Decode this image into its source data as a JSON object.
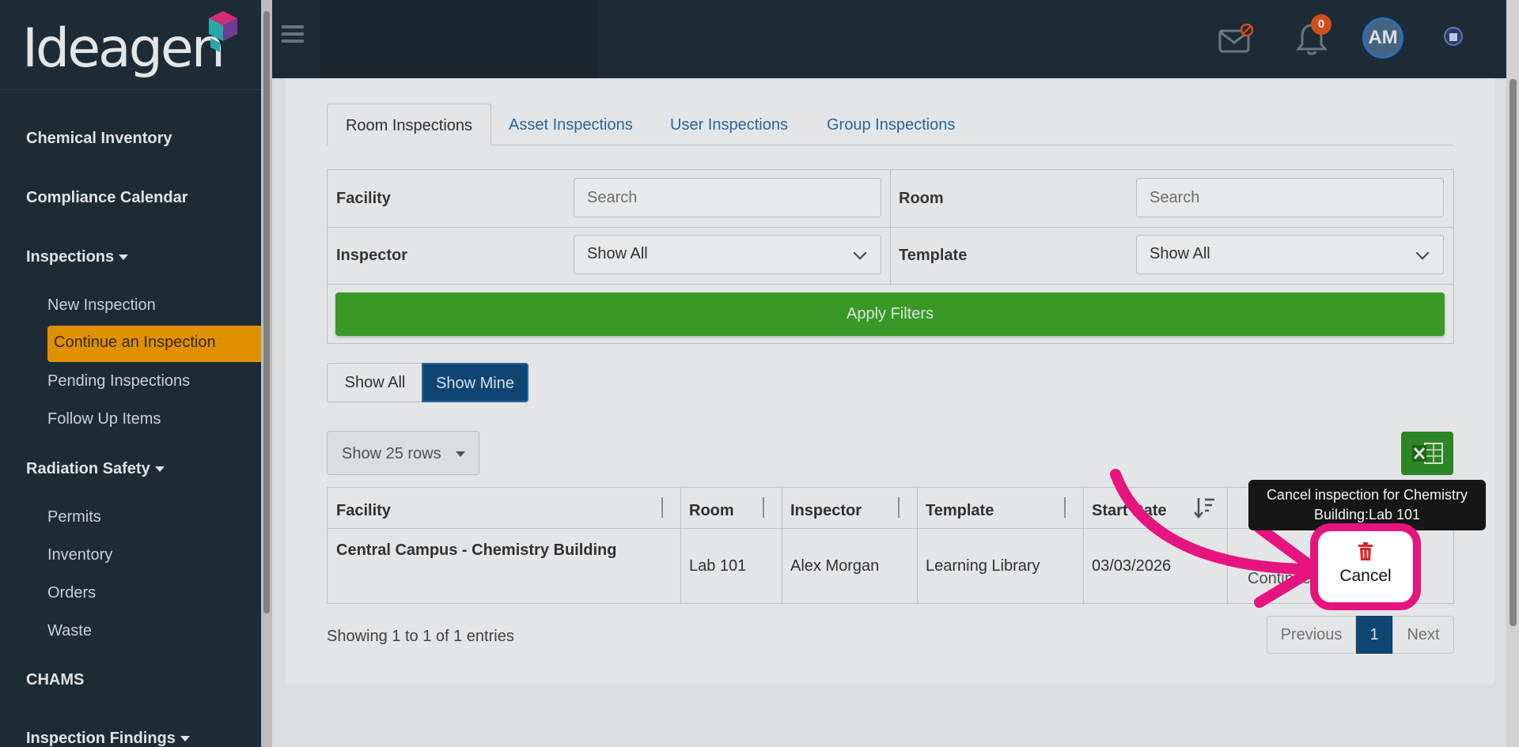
{
  "brand": {
    "name": "Ideagen"
  },
  "sidebar": {
    "sections": [
      {
        "label": "Chemical Inventory"
      },
      {
        "label": "Compliance Calendar"
      },
      {
        "label": "Inspections"
      },
      {
        "label": "Radiation Safety"
      },
      {
        "label": "CHAMS"
      },
      {
        "label": "Inspection Findings"
      }
    ],
    "inspections_items": [
      "New Inspection",
      "Continue an Inspection",
      "Pending Inspections",
      "Follow Up Items"
    ],
    "radiation_items": [
      "Permits",
      "Inventory",
      "Orders",
      "Waste"
    ],
    "active_item": "Continue an Inspection"
  },
  "header": {
    "notifications_count": "0",
    "avatar_initials": "AM"
  },
  "tabs": [
    {
      "label": "Room Inspections"
    },
    {
      "label": "Asset Inspections"
    },
    {
      "label": "User Inspections"
    },
    {
      "label": "Group Inspections"
    }
  ],
  "filters": {
    "facility_label": "Facility",
    "facility_placeholder": "Search",
    "room_label": "Room",
    "room_placeholder": "Search",
    "inspector_label": "Inspector",
    "inspector_value": "Show All",
    "template_label": "Template",
    "template_value": "Show All",
    "apply_label": "Apply Filters"
  },
  "toggle": {
    "all": "Show All",
    "mine": "Show Mine"
  },
  "rows_selector": "Show 25 rows",
  "table": {
    "columns": [
      "Facility",
      "Room",
      "Inspector",
      "Template",
      "Start Date"
    ],
    "rows": [
      {
        "facility": "Central Campus - Chemistry Building",
        "room": "Lab 101",
        "inspector": "Alex Morgan",
        "template": "Learning Library",
        "start_date": "03/03/2026",
        "action": "Continue"
      }
    ]
  },
  "footer": {
    "showing": "Showing 1 to 1 of 1 entries",
    "previous": "Previous",
    "page": "1",
    "next": "Next"
  },
  "tooltip": {
    "text": "Cancel inspection for Chemistry Building:Lab 101"
  },
  "cancel_button": {
    "label": "Cancel"
  },
  "colors": {
    "accent_orange": "#ee9a00",
    "apply_green": "#3da32a",
    "primary_blue": "#124a7a",
    "highlight_pink": "#e6147e",
    "trash_red": "#d9262e"
  }
}
